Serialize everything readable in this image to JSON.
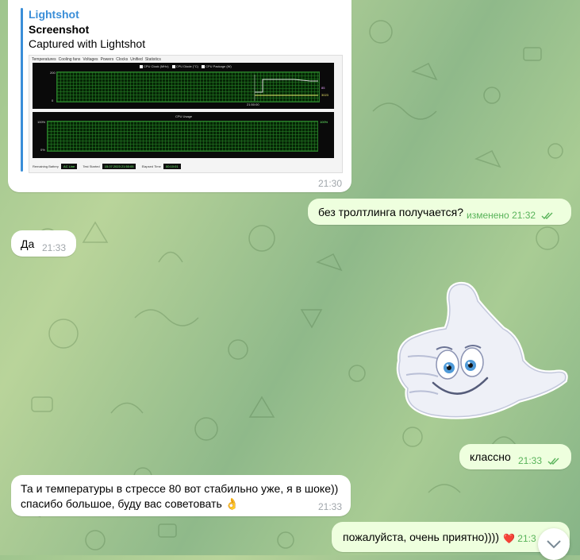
{
  "link_message": {
    "site": "Lightshot",
    "title": "Screenshot",
    "description": "Captured with Lightshot",
    "time": "21:30",
    "preview": {
      "tabs": [
        "Temperatures",
        "Cooling fans",
        "Voltages",
        "Powers",
        "Clocks",
        "Unified",
        "Statistics"
      ],
      "legend": [
        "CPU Clock (MHz)",
        "CPU Diode (°C)",
        "CPU Package (W)"
      ],
      "top_axis_max": "200",
      "top_axis_min": "0",
      "top_time_label": "21:50:00",
      "top_right_values": [
        "85",
        "3023"
      ],
      "usage_title": "CPU Usage",
      "usage_max": "100%",
      "usage_min": "0%",
      "usage_right": "100%",
      "status": {
        "battery_label": "Remaining Battery",
        "battery_value": "AC Line",
        "started_label": "Test Started",
        "started_value": "15.07.2023 21:50:05",
        "elapsed_label": "Elapsed Time",
        "elapsed_value": "00:10:01"
      }
    }
  },
  "messages": [
    {
      "side": "out",
      "text": "без тролтлинга получается?",
      "edited": "изменено",
      "time": "21:32"
    },
    {
      "side": "in",
      "text": "Да",
      "time": "21:33"
    },
    {
      "side": "out",
      "text": "классно",
      "time": "21:33"
    },
    {
      "side": "in",
      "lines": [
        "Та и температуры в стрессе 80 вот стабильно уже, я в шоке))",
        "спасибо большое, буду вас советовать"
      ],
      "emoji": "👌",
      "time": "21:33"
    },
    {
      "side": "out",
      "text": "пожалуйста, очень приятно))))",
      "reaction": "❤️",
      "time": "21:3"
    }
  ],
  "sticker": {
    "name": "thumbs-up-ghost"
  },
  "colors": {
    "accent": "#3a8ed8",
    "outgoing_bubble": "#eeffde",
    "check": "#59b35a"
  }
}
